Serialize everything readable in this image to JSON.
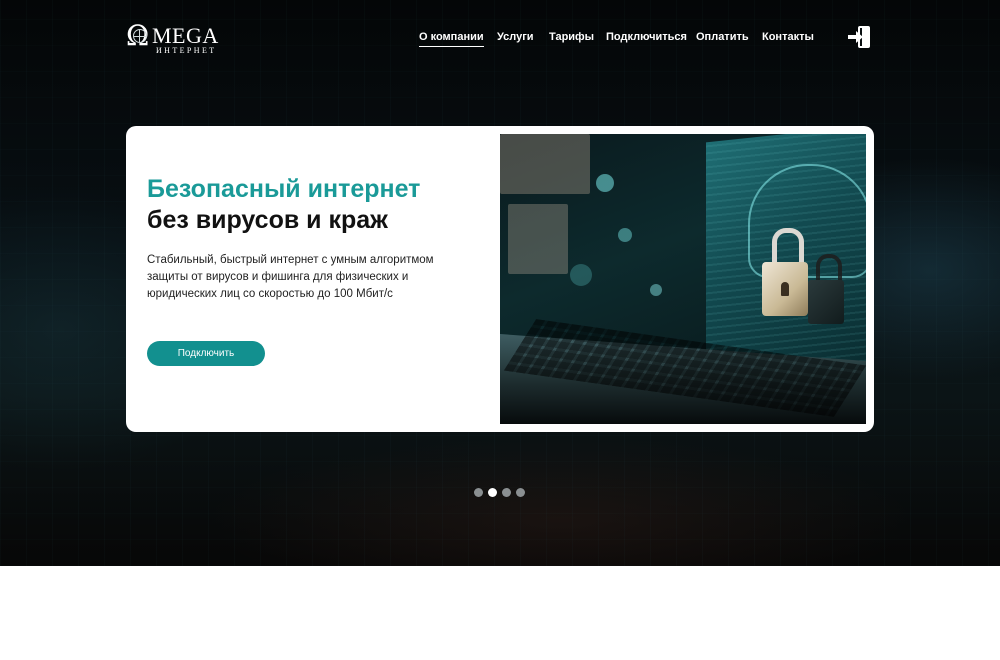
{
  "brand": {
    "name": "MEGA",
    "subtitle": "ИНТЕРНЕТ",
    "omega_glyph": "Ω"
  },
  "nav": {
    "items": [
      {
        "label": "О компании",
        "active": true
      },
      {
        "label": "Услуги",
        "active": false
      },
      {
        "label": "Тарифы",
        "active": false
      },
      {
        "label": "Подключиться",
        "active": false
      },
      {
        "label": "Оплатить",
        "active": false
      },
      {
        "label": "Контакты",
        "active": false
      }
    ],
    "login_icon": "login-icon"
  },
  "hero": {
    "title_line1": "Безопасный интернет",
    "title_line2": "без вирусов и краж",
    "description": "Стабильный, быстрый интернет с умным алгоритмом защиты от вирусов и фишинга для физических и юридических лиц со скоростью до 100 Мбит/с",
    "cta_label": "Подключить",
    "image": "laptop-with-padlock"
  },
  "slider": {
    "count": 4,
    "active_index": 1
  },
  "colors": {
    "accent": "#1a9a98",
    "button": "#12908f",
    "hero_bg": "#081014",
    "text_dark": "#111111"
  }
}
